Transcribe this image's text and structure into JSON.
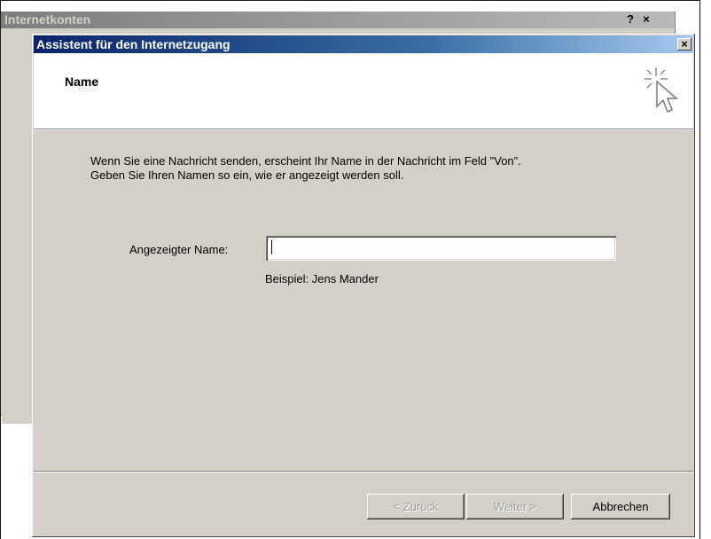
{
  "background_window": {
    "title": "Internetkonten",
    "help_label": "?",
    "close_label": "×"
  },
  "wizard": {
    "title": "Assistent für den Internetzugang",
    "close_label": "×",
    "header_title": "Name",
    "header_icon": "wizard-sparkle-cursor-icon",
    "info_line1": "Wenn Sie eine Nachricht senden, erscheint Ihr Name in der Nachricht im Feld \"Von\".",
    "info_line2": "Geben Sie Ihren Namen so ein, wie er angezeigt werden soll.",
    "field_label": "Angezeigter Name:",
    "field_value": "",
    "example": "Beispiel: Jens Mander",
    "buttons": {
      "back": "< Zurück",
      "next": "Weiter >",
      "cancel": "Abbrechen"
    }
  },
  "colors": {
    "title_bar_start": "#0a246a",
    "title_bar_end": "#a6caf0",
    "dialog_face": "#d4d0c8",
    "inactive_title": "#7d7d7d"
  }
}
